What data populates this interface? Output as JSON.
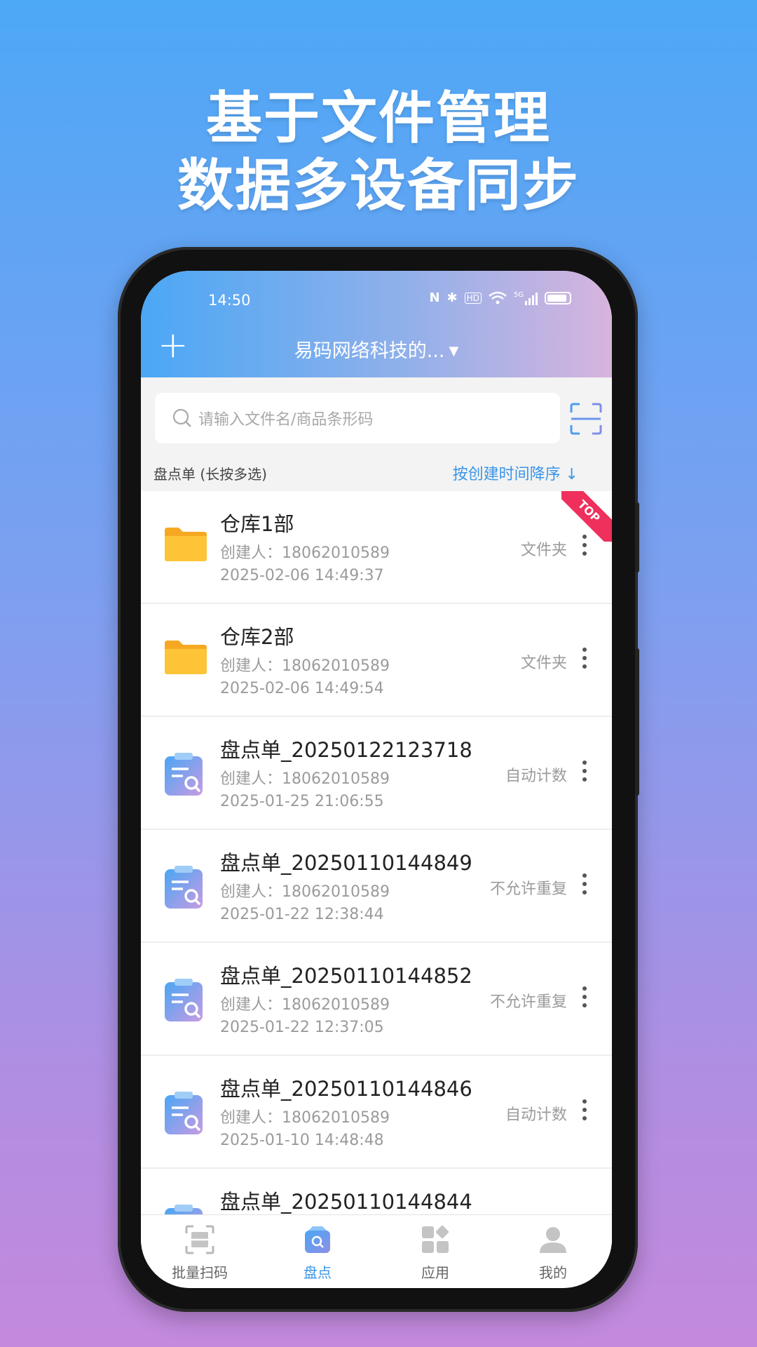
{
  "banner": {
    "line1": "基于文件管理",
    "line2": "数据多设备同步"
  },
  "status_bar": {
    "time": "14:50",
    "network_label": "5G",
    "hd_label": "HD"
  },
  "header": {
    "add_icon": "plus-icon",
    "title": "易码网络科技的...",
    "title_caret": "▼"
  },
  "search": {
    "placeholder": "请输入文件名/商品条形码"
  },
  "list": {
    "section_label": "盘点单 (长按多选)",
    "sort_label": "按创建时间降序 ↓",
    "top_badge": "TOP",
    "rows": [
      {
        "name": "仓库1部",
        "creator": "创建人：18062010589",
        "time": "2025-02-06 14:49:37",
        "type": "文件夹",
        "icon": "folder-icon"
      },
      {
        "name": "仓库2部",
        "creator": "创建人：18062010589",
        "time": "2025-02-06 14:49:54",
        "type": "文件夹",
        "icon": "folder-icon"
      },
      {
        "name": "盘点单_20250122123718",
        "creator": "创建人：18062010589",
        "time": "2025-01-25 21:06:55",
        "type": "自动计数",
        "icon": "clipboard-search-icon"
      },
      {
        "name": "盘点单_20250110144849",
        "creator": "创建人：18062010589",
        "time": "2025-01-22 12:38:44",
        "type": "不允许重复",
        "icon": "clipboard-search-icon"
      },
      {
        "name": "盘点单_20250110144852",
        "creator": "创建人：18062010589",
        "time": "2025-01-22 12:37:05",
        "type": "不允许重复",
        "icon": "clipboard-search-icon"
      },
      {
        "name": "盘点单_20250110144846",
        "creator": "创建人：18062010589",
        "time": "2025-01-10 14:48:48",
        "type": "自动计数",
        "icon": "clipboard-search-icon"
      },
      {
        "name": "盘点单_20250110144844",
        "creator": "",
        "time": "",
        "type": "",
        "icon": "clipboard-search-icon"
      }
    ]
  },
  "tabs": [
    {
      "label": "批量扫码",
      "icon": "scan-icon"
    },
    {
      "label": "盘点",
      "icon": "inventory-icon"
    },
    {
      "label": "应用",
      "icon": "apps-icon"
    },
    {
      "label": "我的",
      "icon": "user-icon"
    }
  ],
  "colors": {
    "accent": "#3a95e8",
    "folder": "#fbbf2a",
    "badge": "#ef2f5c"
  }
}
